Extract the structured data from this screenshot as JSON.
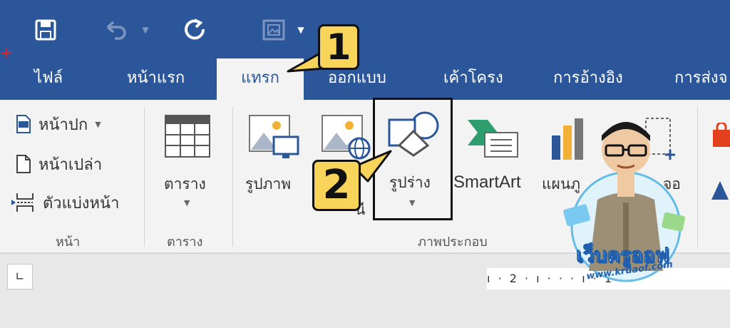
{
  "colors": {
    "brand": "#2b579a",
    "ribbon": "#f3f3f3",
    "callout": "#f8d55a",
    "accent_red": "#e82020"
  },
  "quick_access": {
    "icons": [
      "save-icon",
      "undo-icon",
      "undo-dropdown-icon",
      "redo-icon",
      "picture-icon",
      "customize-dropdown-icon"
    ]
  },
  "tabs": [
    {
      "label": "ไฟล์",
      "active": false
    },
    {
      "label": "หน้าแรก",
      "active": false
    },
    {
      "label": "แทรก",
      "active": true
    },
    {
      "label": "ออกแบบ",
      "active": false
    },
    {
      "label": "เค้าโครง",
      "active": false
    },
    {
      "label": "การอ้างอิง",
      "active": false
    },
    {
      "label": "การส่งจ",
      "active": false
    }
  ],
  "ribbon": {
    "pages_group": {
      "items": [
        {
          "label": "หน้าปก",
          "icon": "cover-page-icon",
          "has_dropdown": true
        },
        {
          "label": "หน้าเปล่า",
          "icon": "blank-page-icon"
        },
        {
          "label": "ตัวแบ่งหน้า",
          "icon": "page-break-icon"
        }
      ],
      "label": "หน้า"
    },
    "tables_group": {
      "button_label": "ตาราง",
      "label": "ตาราง"
    },
    "illustrations_group": {
      "buttons": [
        {
          "label": "รูปภาพ",
          "icon": "pictures-icon"
        },
        {
          "label": "ี่",
          "icon": "online-pictures-icon",
          "sub": "นี"
        },
        {
          "label": "รูปร่าง",
          "icon": "shapes-icon"
        },
        {
          "label": "SmartArt",
          "icon": "smartart-icon"
        },
        {
          "label": "แผนภู",
          "icon": "chart-icon"
        },
        {
          "label": "จอ",
          "icon": "screenshot-icon"
        }
      ],
      "label": "ภาพประกอบ"
    }
  },
  "ruler": {
    "tab_selector": "∟",
    "marks": "ı · 2 · ı · ·                 · ı · 1 ·"
  },
  "callouts": {
    "step1": "1",
    "step2": "2"
  },
  "watermark": {
    "title": "เว็บครูออฟ",
    "url": "www.kruaof.com"
  }
}
